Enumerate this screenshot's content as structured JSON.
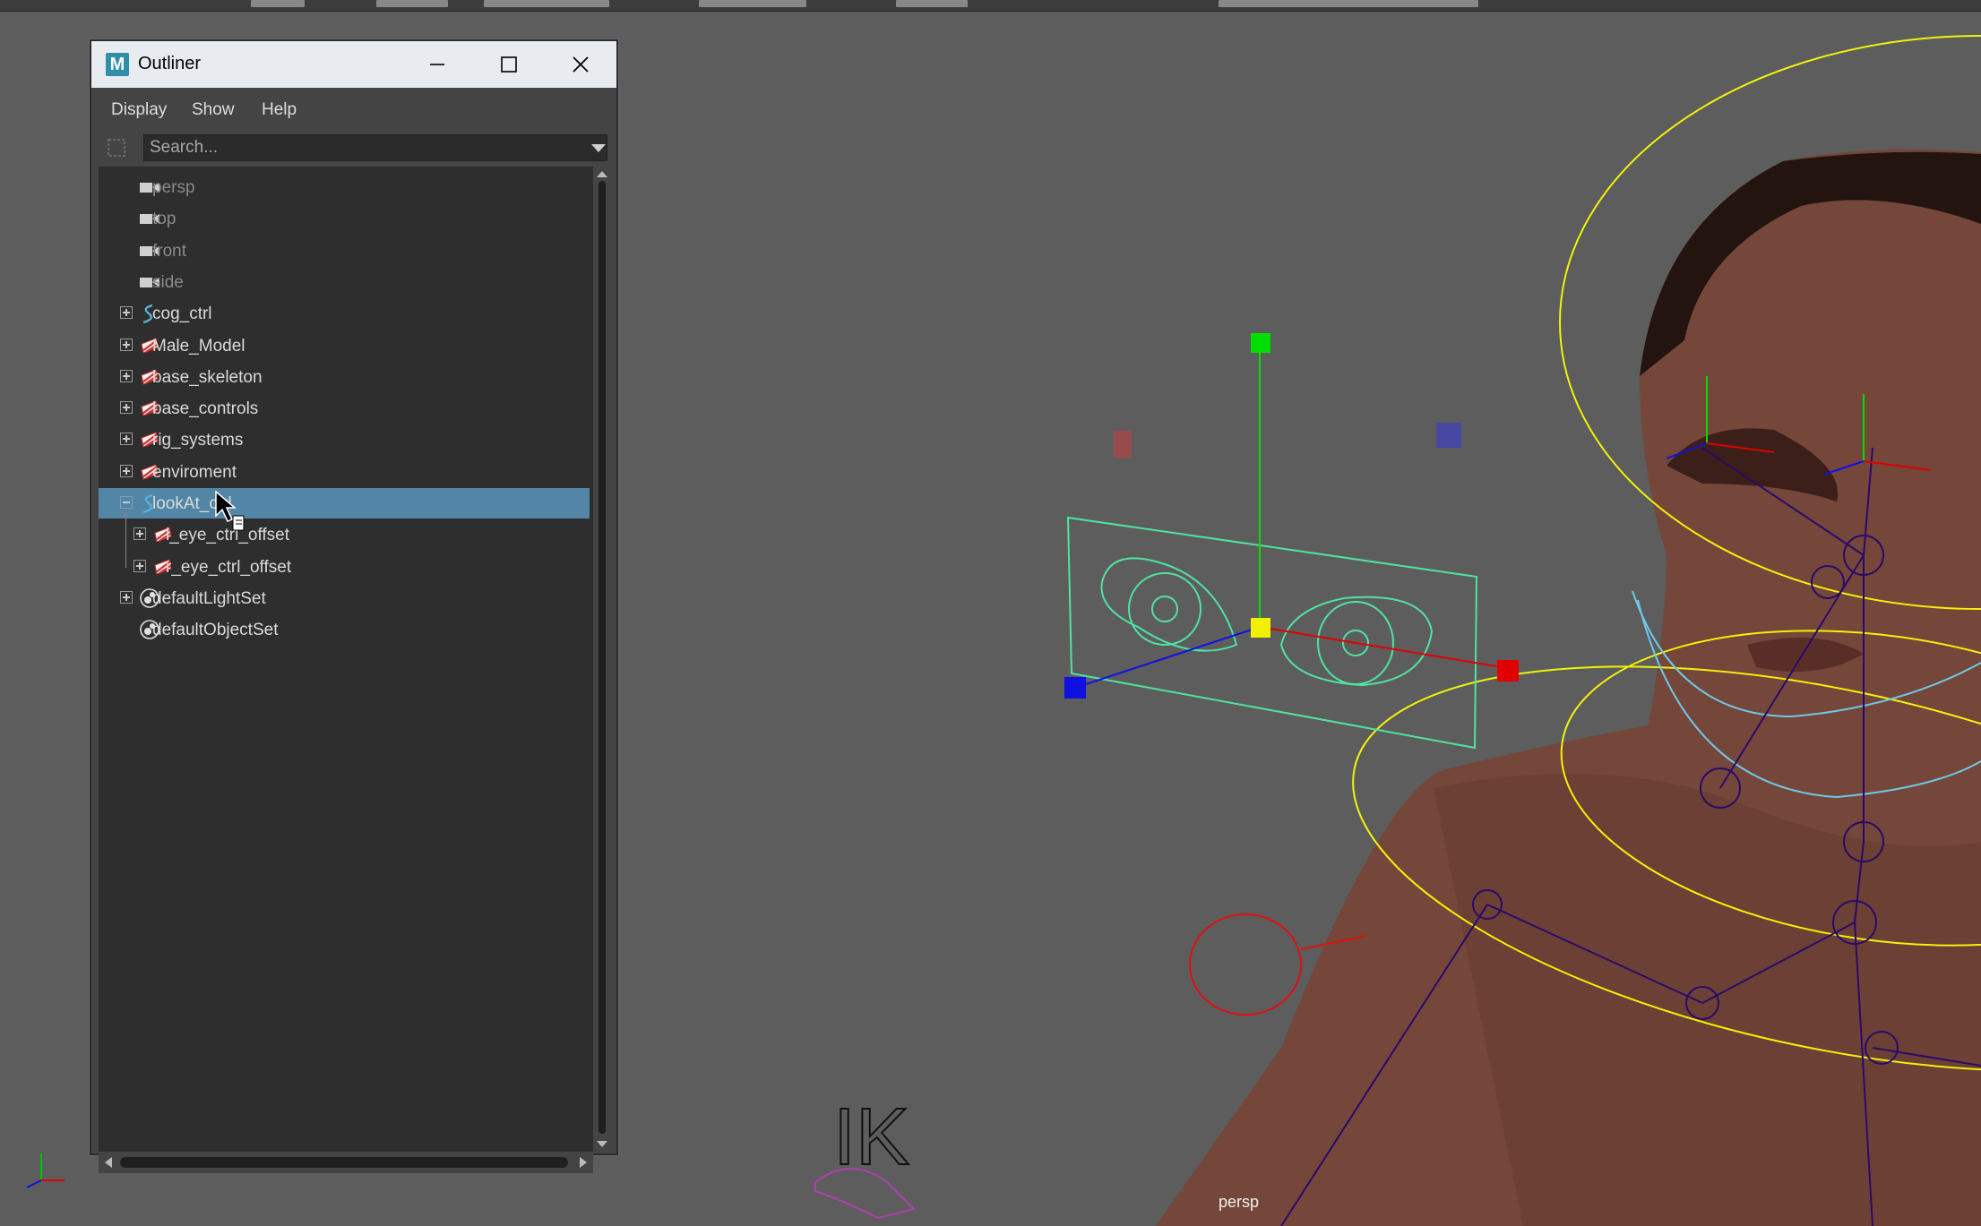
{
  "window": {
    "title": "Outliner",
    "logo_letter": "M",
    "controls": [
      "minimize-icon",
      "maximize-icon",
      "close-icon"
    ]
  },
  "menu": {
    "items": [
      "Display",
      "Show",
      "Help"
    ]
  },
  "search": {
    "placeholder": "Search..."
  },
  "tree": {
    "items": [
      {
        "label": "persp",
        "icon": "camera-icon",
        "depth": 0,
        "expander": "none",
        "dim": true
      },
      {
        "label": "top",
        "icon": "camera-icon",
        "depth": 0,
        "expander": "none",
        "dim": true
      },
      {
        "label": "front",
        "icon": "camera-icon",
        "depth": 0,
        "expander": "none",
        "dim": true
      },
      {
        "label": "side",
        "icon": "camera-icon",
        "depth": 0,
        "expander": "none",
        "dim": true
      },
      {
        "label": "cog_ctrl",
        "icon": "curve-icon",
        "depth": 0,
        "expander": "plus",
        "dim": false
      },
      {
        "label": "Male_Model",
        "icon": "group-icon",
        "depth": 0,
        "expander": "plus",
        "dim": false
      },
      {
        "label": "base_skeleton",
        "icon": "group-icon",
        "depth": 0,
        "expander": "plus",
        "dim": false
      },
      {
        "label": "base_controls",
        "icon": "group-icon",
        "depth": 0,
        "expander": "plus",
        "dim": false
      },
      {
        "label": "rig_systems",
        "icon": "group-icon",
        "depth": 0,
        "expander": "plus",
        "dim": false
      },
      {
        "label": "enviroment",
        "icon": "group-icon",
        "depth": 0,
        "expander": "plus",
        "dim": false
      },
      {
        "label": "lookAt_ctrl",
        "icon": "curve-icon",
        "depth": 0,
        "expander": "minus",
        "dim": false,
        "selected": true
      },
      {
        "label": "l_eye_ctrl_offset",
        "icon": "group-icon",
        "depth": 1,
        "expander": "plus",
        "dim": false
      },
      {
        "label": "r_eye_ctrl_offset",
        "icon": "group-icon",
        "depth": 1,
        "expander": "plus",
        "dim": false
      },
      {
        "label": "defaultLightSet",
        "icon": "set-icon",
        "depth": 0,
        "expander": "plus",
        "dim": false
      },
      {
        "label": "defaultObjectSet",
        "icon": "set-icon",
        "depth": 0,
        "expander": "none",
        "dim": false
      }
    ]
  },
  "viewport": {
    "camera_label": "persp",
    "axis_labels": [
      "x",
      "y",
      "z"
    ],
    "ik_label": "IK",
    "colors": {
      "background": "#5d5d5d",
      "selection": "#5285a6",
      "control_green": "#4fe3a0",
      "rig_yellow": "#f2f20a",
      "joint_purple": "#2a0a6a",
      "jaw_ctrl_cyan": "#6fc8e8"
    }
  }
}
